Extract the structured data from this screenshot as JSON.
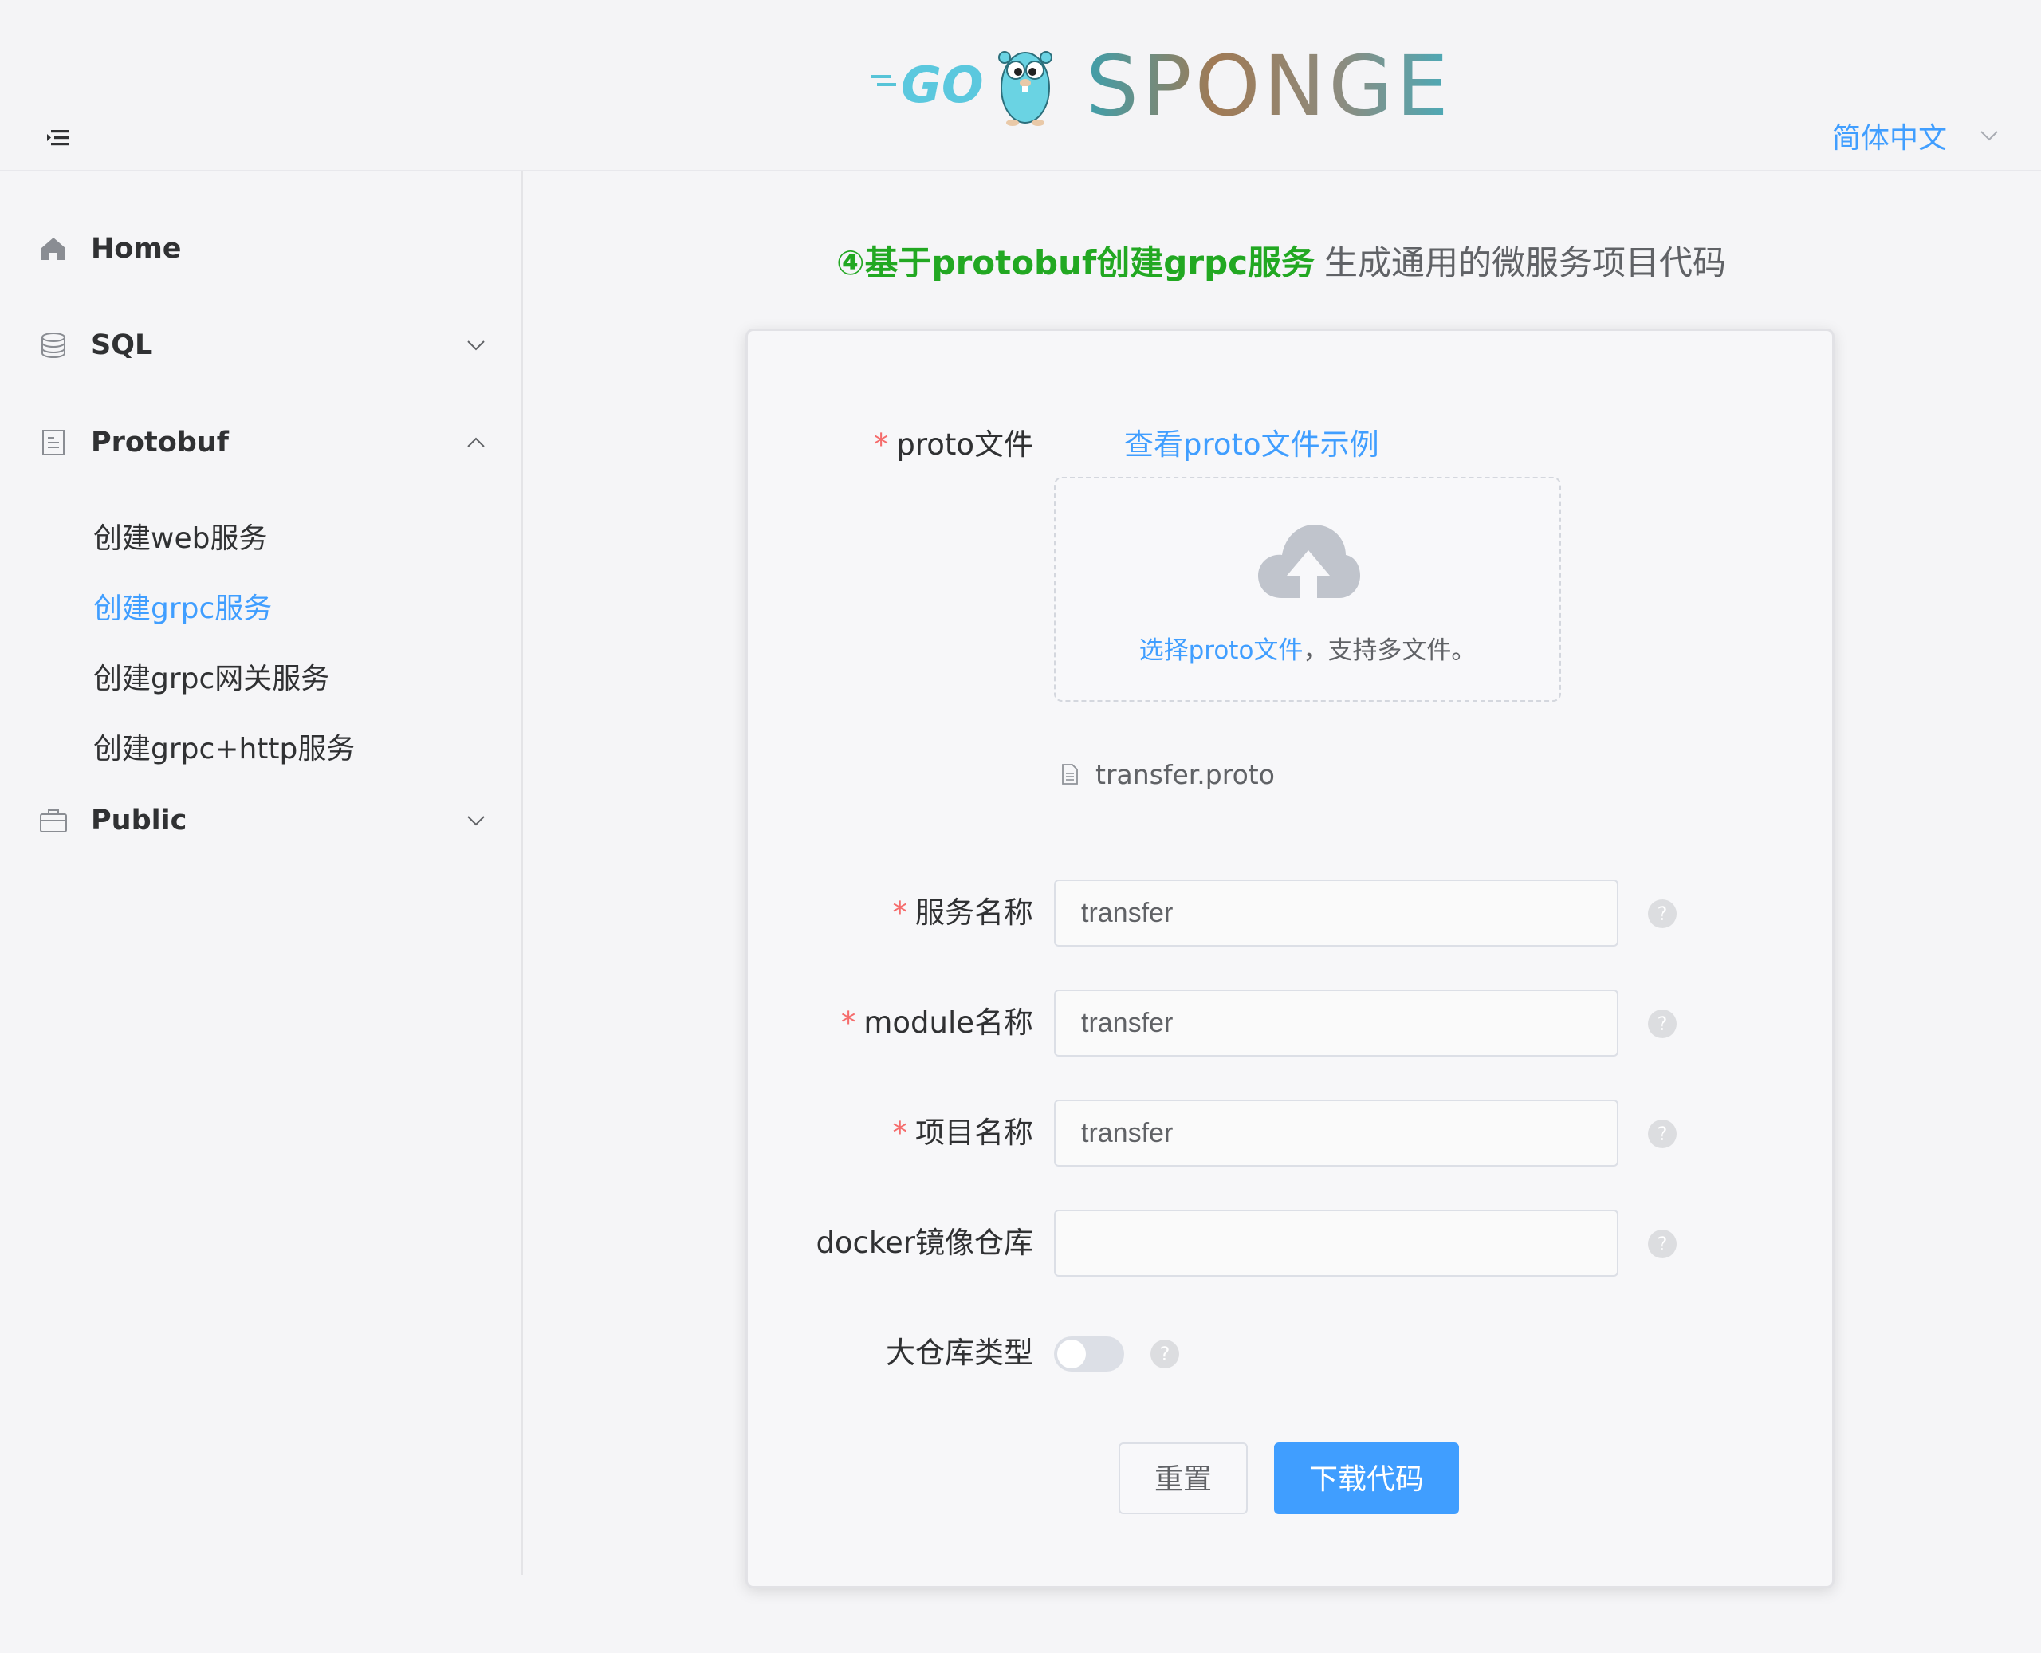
{
  "header": {
    "logo_go_text": "GO",
    "logo_brand_text": "SPONGE",
    "language": "简体中文"
  },
  "sidebar": {
    "items": [
      {
        "label": "Home",
        "icon": "home-icon"
      },
      {
        "label": "SQL",
        "icon": "database-icon",
        "expanded": false
      },
      {
        "label": "Protobuf",
        "icon": "document-icon",
        "expanded": true,
        "children": [
          {
            "label": "创建web服务",
            "active": false
          },
          {
            "label": "创建grpc服务",
            "active": true
          },
          {
            "label": "创建grpc网关服务",
            "active": false
          },
          {
            "label": "创建grpc+http服务",
            "active": false
          }
        ]
      },
      {
        "label": "Public",
        "icon": "briefcase-icon",
        "expanded": false
      }
    ]
  },
  "page": {
    "title_strong": "④基于protobuf创建grpc服务",
    "title_rest": "生成通用的微服务项目代码"
  },
  "form": {
    "proto_label": "proto文件",
    "example_link": "查看proto文件示例",
    "upload_link": "选择proto文件",
    "upload_hint": "，支持多文件。",
    "file_name": "transfer.proto",
    "service_name_label": "服务名称",
    "service_name_value": "transfer",
    "module_name_label": "module名称",
    "module_name_value": "transfer",
    "project_name_label": "项目名称",
    "project_name_value": "transfer",
    "docker_repo_label": "docker镜像仓库",
    "docker_repo_value": "",
    "mono_repo_label": "大仓库类型",
    "mono_repo_enabled": false,
    "required_mark": "*",
    "reset_button": "重置",
    "download_button": "下载代码"
  },
  "colors": {
    "accent": "#409eff",
    "title_green": "#22a822",
    "required": "#f56c6c"
  }
}
